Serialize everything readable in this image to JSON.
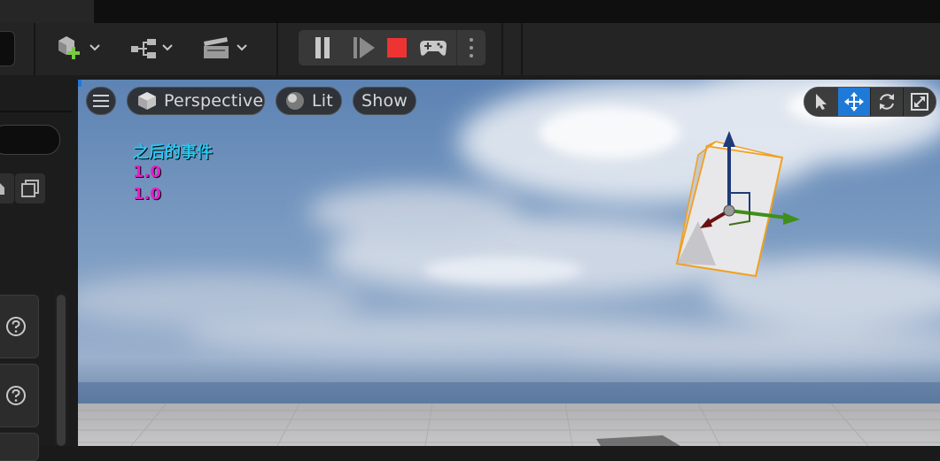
{
  "toolbar": {
    "icons": [
      "add-actor-icon",
      "chevron-down-icon",
      "blueprint-icon",
      "chevron-down-icon",
      "cinematics-icon",
      "chevron-down-icon"
    ],
    "play_controls": [
      "pause-icon",
      "step-forward-icon",
      "stop-icon",
      "gamepad-icon",
      "more-options-icon"
    ]
  },
  "viewport": {
    "menu_icon": "hamburger-icon",
    "perspective_label": "Perspective",
    "lit_label": "Lit",
    "show_label": "Show",
    "transform_tools": [
      "select-icon",
      "translate-icon",
      "rotate-icon",
      "scale-icon"
    ],
    "active_tool": "translate-icon",
    "overlay": {
      "event_text": "之后的事件",
      "value_1": "1.0",
      "value_2": "1.0",
      "event_color": "#29c6f0",
      "value_color": "#e61ec8"
    }
  },
  "colors": {
    "accent_blue": "#1e7ad6",
    "stop_red": "#ee3333",
    "add_green": "#7ac943"
  }
}
